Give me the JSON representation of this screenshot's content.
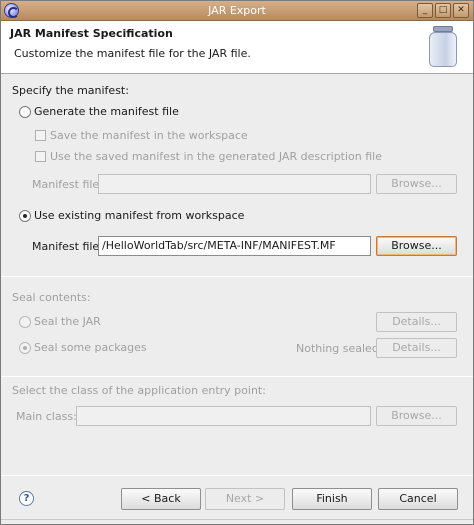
{
  "window": {
    "title": "JAR Export",
    "controls": {
      "minimize": "_",
      "maximize": "□",
      "close": "✕"
    }
  },
  "header": {
    "title": "JAR Manifest Specification",
    "description": "Customize the manifest file for the JAR file.",
    "icon": "jar-icon"
  },
  "manifest": {
    "section_label": "Specify the manifest:",
    "generate_radio": "Generate the manifest file",
    "save_checkbox": "Save the manifest in the workspace",
    "reuse_checkbox": "Use the saved manifest in the generated JAR description file",
    "generated_file_label": "Manifest file:",
    "generated_file_value": "",
    "browse_disabled": "Browse...",
    "existing_radio": "Use existing manifest from workspace",
    "existing_file_label": "Manifest file:",
    "existing_file_value": "/HelloWorldTab/src/META-INF/MANIFEST.MF",
    "browse": "Browse..."
  },
  "seal": {
    "section_label": "Seal contents:",
    "seal_jar": "Seal the JAR",
    "seal_packages": "Seal some packages",
    "details_1": "Details...",
    "status": "Nothing sealed",
    "details_2": "Details..."
  },
  "entry": {
    "section_label": "Select the class of the application entry point:",
    "main_class_label": "Main class:",
    "main_class_value": "",
    "browse": "Browse..."
  },
  "footer": {
    "help_glyph": "?",
    "back": "< Back",
    "next": "Next >",
    "finish": "Finish",
    "cancel": "Cancel"
  }
}
